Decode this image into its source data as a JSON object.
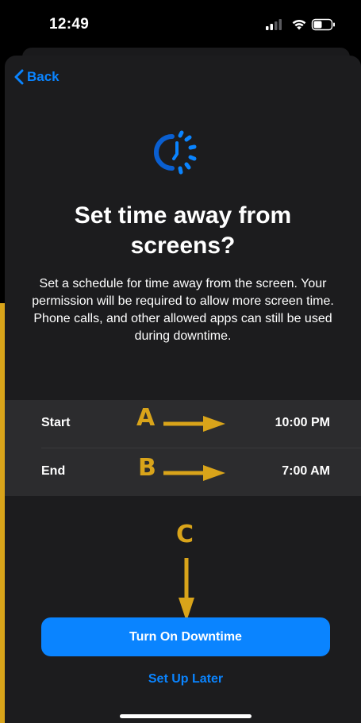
{
  "status_bar": {
    "time": "12:49",
    "signal_icon": "cellular-signal-icon",
    "wifi_icon": "wifi-icon",
    "battery_icon": "battery-icon"
  },
  "nav": {
    "back_label": "Back",
    "back_icon": "chevron-left-icon"
  },
  "hero": {
    "icon": "downtime-clock-icon",
    "title": "Set time away from screens?",
    "description": "Set a schedule for time away from the screen. Your permission will be required to allow more screen time. Phone calls, and other allowed apps can still be used during downtime."
  },
  "schedule": {
    "start": {
      "label": "Start",
      "value": "10:00 PM"
    },
    "end": {
      "label": "End",
      "value": "7:00 AM"
    }
  },
  "annotations": {
    "a": "A",
    "b": "B",
    "c": "C",
    "color": "#d9a41a"
  },
  "actions": {
    "primary_label": "Turn On Downtime",
    "secondary_label": "Set Up Later"
  },
  "colors": {
    "accent": "#0a84ff",
    "sheet_background": "#1c1c1e",
    "row_background": "#2c2c2e"
  }
}
